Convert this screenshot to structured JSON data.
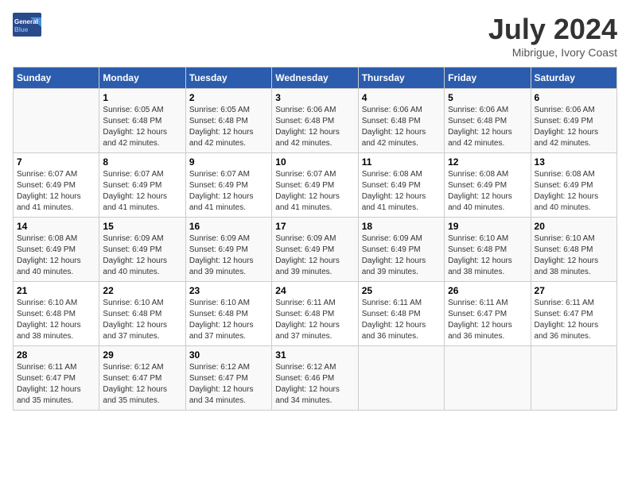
{
  "header": {
    "logo_line1": "General",
    "logo_line2": "Blue",
    "month": "July 2024",
    "location": "Mibrigue, Ivory Coast"
  },
  "weekdays": [
    "Sunday",
    "Monday",
    "Tuesday",
    "Wednesday",
    "Thursday",
    "Friday",
    "Saturday"
  ],
  "weeks": [
    [
      {
        "day": "",
        "info": ""
      },
      {
        "day": "1",
        "info": "Sunrise: 6:05 AM\nSunset: 6:48 PM\nDaylight: 12 hours\nand 42 minutes."
      },
      {
        "day": "2",
        "info": "Sunrise: 6:05 AM\nSunset: 6:48 PM\nDaylight: 12 hours\nand 42 minutes."
      },
      {
        "day": "3",
        "info": "Sunrise: 6:06 AM\nSunset: 6:48 PM\nDaylight: 12 hours\nand 42 minutes."
      },
      {
        "day": "4",
        "info": "Sunrise: 6:06 AM\nSunset: 6:48 PM\nDaylight: 12 hours\nand 42 minutes."
      },
      {
        "day": "5",
        "info": "Sunrise: 6:06 AM\nSunset: 6:48 PM\nDaylight: 12 hours\nand 42 minutes."
      },
      {
        "day": "6",
        "info": "Sunrise: 6:06 AM\nSunset: 6:49 PM\nDaylight: 12 hours\nand 42 minutes."
      }
    ],
    [
      {
        "day": "7",
        "info": "Sunrise: 6:07 AM\nSunset: 6:49 PM\nDaylight: 12 hours\nand 41 minutes."
      },
      {
        "day": "8",
        "info": "Sunrise: 6:07 AM\nSunset: 6:49 PM\nDaylight: 12 hours\nand 41 minutes."
      },
      {
        "day": "9",
        "info": "Sunrise: 6:07 AM\nSunset: 6:49 PM\nDaylight: 12 hours\nand 41 minutes."
      },
      {
        "day": "10",
        "info": "Sunrise: 6:07 AM\nSunset: 6:49 PM\nDaylight: 12 hours\nand 41 minutes."
      },
      {
        "day": "11",
        "info": "Sunrise: 6:08 AM\nSunset: 6:49 PM\nDaylight: 12 hours\nand 41 minutes."
      },
      {
        "day": "12",
        "info": "Sunrise: 6:08 AM\nSunset: 6:49 PM\nDaylight: 12 hours\nand 40 minutes."
      },
      {
        "day": "13",
        "info": "Sunrise: 6:08 AM\nSunset: 6:49 PM\nDaylight: 12 hours\nand 40 minutes."
      }
    ],
    [
      {
        "day": "14",
        "info": "Sunrise: 6:08 AM\nSunset: 6:49 PM\nDaylight: 12 hours\nand 40 minutes."
      },
      {
        "day": "15",
        "info": "Sunrise: 6:09 AM\nSunset: 6:49 PM\nDaylight: 12 hours\nand 40 minutes."
      },
      {
        "day": "16",
        "info": "Sunrise: 6:09 AM\nSunset: 6:49 PM\nDaylight: 12 hours\nand 39 minutes."
      },
      {
        "day": "17",
        "info": "Sunrise: 6:09 AM\nSunset: 6:49 PM\nDaylight: 12 hours\nand 39 minutes."
      },
      {
        "day": "18",
        "info": "Sunrise: 6:09 AM\nSunset: 6:49 PM\nDaylight: 12 hours\nand 39 minutes."
      },
      {
        "day": "19",
        "info": "Sunrise: 6:10 AM\nSunset: 6:48 PM\nDaylight: 12 hours\nand 38 minutes."
      },
      {
        "day": "20",
        "info": "Sunrise: 6:10 AM\nSunset: 6:48 PM\nDaylight: 12 hours\nand 38 minutes."
      }
    ],
    [
      {
        "day": "21",
        "info": "Sunrise: 6:10 AM\nSunset: 6:48 PM\nDaylight: 12 hours\nand 38 minutes."
      },
      {
        "day": "22",
        "info": "Sunrise: 6:10 AM\nSunset: 6:48 PM\nDaylight: 12 hours\nand 37 minutes."
      },
      {
        "day": "23",
        "info": "Sunrise: 6:10 AM\nSunset: 6:48 PM\nDaylight: 12 hours\nand 37 minutes."
      },
      {
        "day": "24",
        "info": "Sunrise: 6:11 AM\nSunset: 6:48 PM\nDaylight: 12 hours\nand 37 minutes."
      },
      {
        "day": "25",
        "info": "Sunrise: 6:11 AM\nSunset: 6:48 PM\nDaylight: 12 hours\nand 36 minutes."
      },
      {
        "day": "26",
        "info": "Sunrise: 6:11 AM\nSunset: 6:47 PM\nDaylight: 12 hours\nand 36 minutes."
      },
      {
        "day": "27",
        "info": "Sunrise: 6:11 AM\nSunset: 6:47 PM\nDaylight: 12 hours\nand 36 minutes."
      }
    ],
    [
      {
        "day": "28",
        "info": "Sunrise: 6:11 AM\nSunset: 6:47 PM\nDaylight: 12 hours\nand 35 minutes."
      },
      {
        "day": "29",
        "info": "Sunrise: 6:12 AM\nSunset: 6:47 PM\nDaylight: 12 hours\nand 35 minutes."
      },
      {
        "day": "30",
        "info": "Sunrise: 6:12 AM\nSunset: 6:47 PM\nDaylight: 12 hours\nand 34 minutes."
      },
      {
        "day": "31",
        "info": "Sunrise: 6:12 AM\nSunset: 6:46 PM\nDaylight: 12 hours\nand 34 minutes."
      },
      {
        "day": "",
        "info": ""
      },
      {
        "day": "",
        "info": ""
      },
      {
        "day": "",
        "info": ""
      }
    ]
  ]
}
